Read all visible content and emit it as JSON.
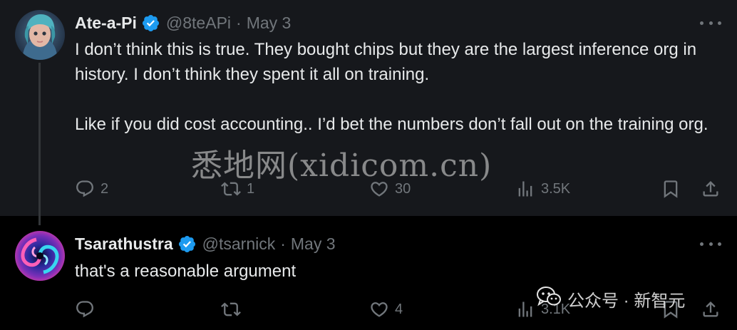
{
  "thread": {
    "tweets": [
      {
        "display_name": "Ate-a-Pi",
        "handle": "@8teAPi",
        "separator": "·",
        "date": "May 3",
        "verified": true,
        "paragraphs": [
          "I don’t think this is true. They bought chips but they are the largest inference org in history. I don’t think they spent it all on training.",
          "Like if you did cost accounting.. I’d bet the numbers don’t fall out on the training org."
        ],
        "actions": {
          "reply_count": "2",
          "retweet_count": "1",
          "like_count": "30",
          "view_count": "3.5K"
        }
      },
      {
        "display_name": "Tsarathustra",
        "handle": "@tsarnick",
        "separator": "·",
        "date": "May 3",
        "verified": true,
        "paragraphs": [
          "that's a reasonable argument"
        ],
        "actions": {
          "reply_count": "",
          "retweet_count": "",
          "like_count": "4",
          "view_count": "3.1K"
        }
      }
    ]
  },
  "overlays": {
    "watermark_text": "悉地网(xidicom.cn)",
    "credit_text": "公众号 · 新智元"
  },
  "colors": {
    "background": "#000000",
    "highlight_background": "#16181c",
    "text_primary": "#e7e9ea",
    "text_secondary": "#71767b",
    "verified_badge": "#1d9bf0",
    "thread_line": "#333639"
  },
  "icons": {
    "verified": "verified-badge-icon",
    "more": "more-horizontal-icon",
    "reply": "reply-icon",
    "retweet": "retweet-icon",
    "like": "heart-icon",
    "views": "views-bar-chart-icon",
    "bookmark": "bookmark-icon",
    "share": "share-icon",
    "wechat": "wechat-icon"
  }
}
